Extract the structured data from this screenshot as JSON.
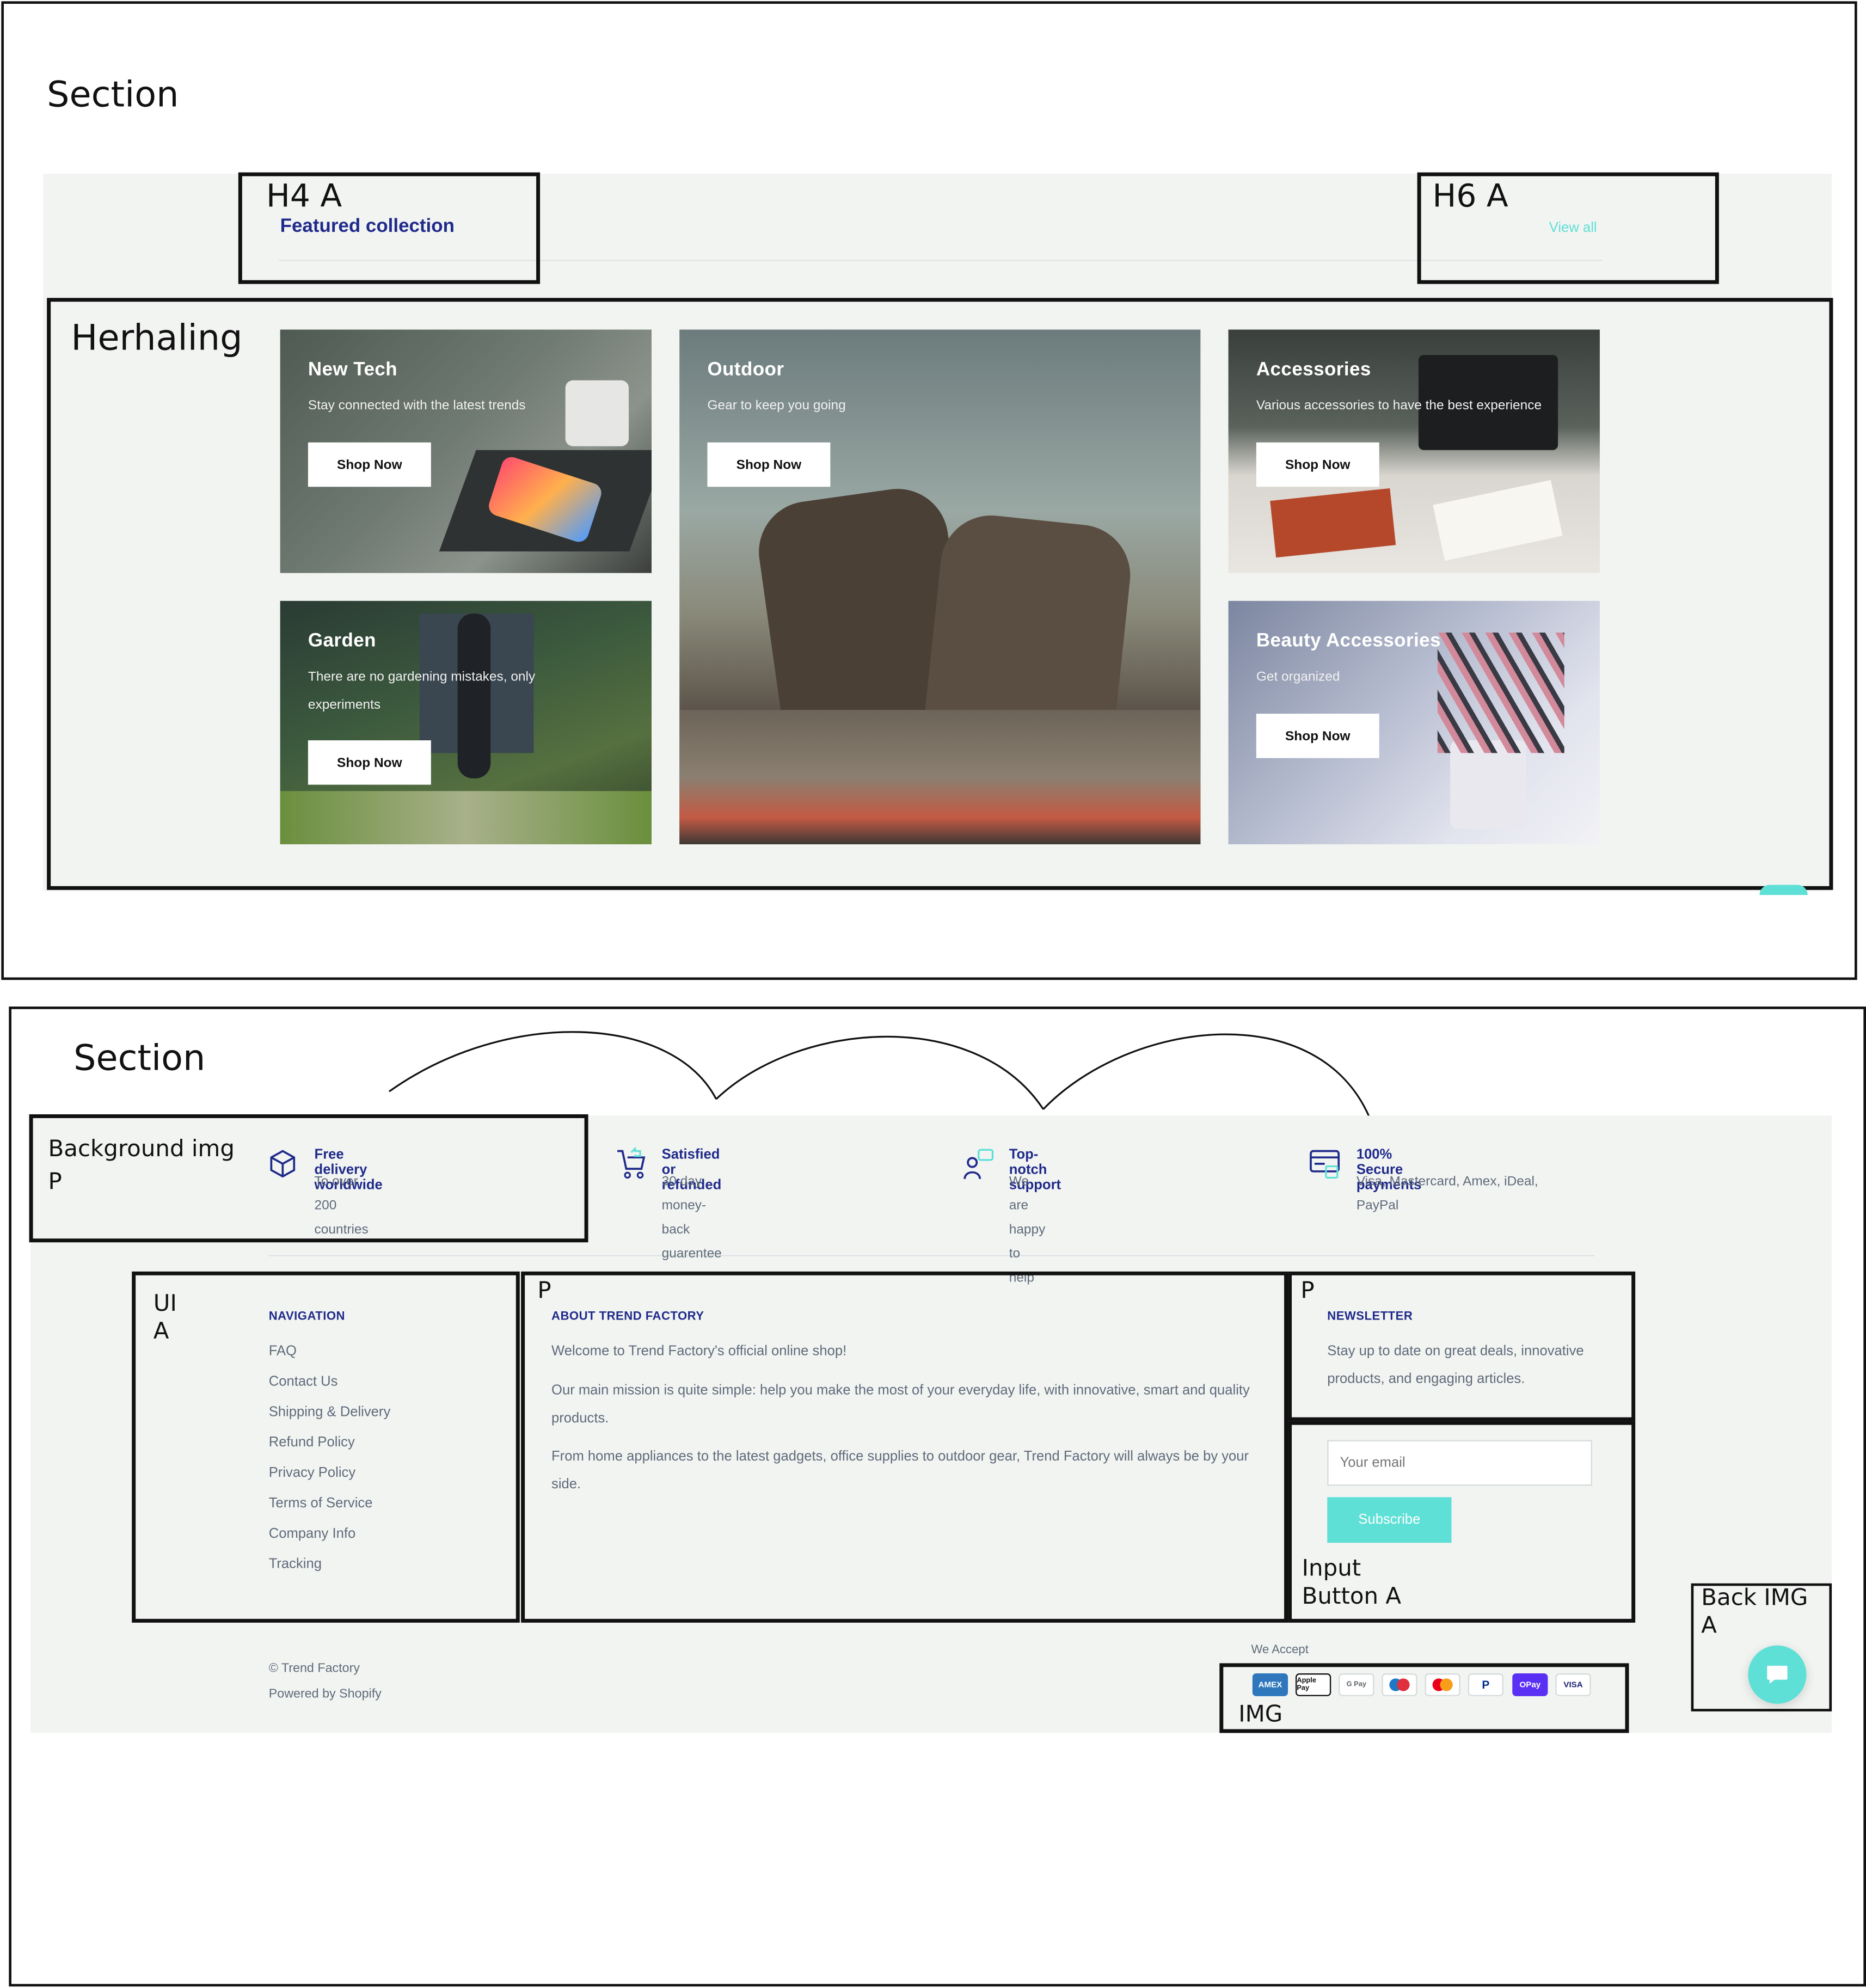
{
  "annotations": {
    "section_top": "Section",
    "h4a": "H4 A",
    "h6a": "H6 A",
    "herhaling": "Herhaling",
    "section_bottom": "Section",
    "bg_img_p": "Background img\nP",
    "ui_a": "UI\nA",
    "p_about": "P",
    "p_news": "P",
    "input_button": "Input\nButton A",
    "back_img": "Back IMG\nA",
    "img": "IMG"
  },
  "collection": {
    "heading": "Featured collection",
    "view_all": "View all",
    "cards": [
      {
        "title": "New Tech",
        "subtitle": "Stay connected with the latest trends",
        "button": "Shop Now"
      },
      {
        "title": "Outdoor",
        "subtitle": "Gear to keep you going",
        "button": "Shop Now"
      },
      {
        "title": "Accessories",
        "subtitle": "Various accessories to have the best experience",
        "button": "Shop Now"
      },
      {
        "title": "Garden",
        "subtitle": "There are no gardening mistakes, only experiments",
        "button": "Shop Now"
      },
      {
        "title": "Beauty Accessories",
        "subtitle": "Get organized",
        "button": "Shop Now"
      }
    ]
  },
  "features": [
    {
      "icon": "box-icon",
      "title": "Free delivery worldwide",
      "subtitle": "To over 200 countries"
    },
    {
      "icon": "cart-return-icon",
      "title": "Satisfied or refunded",
      "subtitle": "30 day money-back guarentee"
    },
    {
      "icon": "support-chat-icon",
      "title": "Top-notch support",
      "subtitle": "We are happy to help"
    },
    {
      "icon": "secure-card-icon",
      "title": "100% Secure payments",
      "subtitle": "Visa, Mastercard, Amex, iDeal, PayPal"
    }
  ],
  "footer": {
    "navigation": {
      "heading": "NAVIGATION",
      "links": [
        "FAQ",
        "Contact Us",
        "Shipping & Delivery",
        "Refund Policy",
        "Privacy Policy",
        "Terms of Service",
        "Company Info",
        "Tracking"
      ]
    },
    "about": {
      "heading": "ABOUT TREND FACTORY",
      "paragraphs": [
        "Welcome to Trend Factory's official online shop!",
        "Our main mission is quite simple: help you make the most of your everyday life, with innovative, smart and quality products.",
        "From home appliances to the latest gadgets, office supplies to outdoor gear, Trend Factory will always be by your side."
      ]
    },
    "newsletter": {
      "heading": "NEWSLETTER",
      "text": "Stay up to date on great deals, innovative products, and engaging articles.",
      "email_placeholder": "Your email",
      "subscribe": "Subscribe"
    },
    "copyright": "© Trend Factory",
    "powered": "Powered by Shopify",
    "we_accept": "We Accept",
    "payments": [
      "AMEX",
      "Apple Pay",
      "G Pay",
      "Maestro",
      "Mastercard",
      "PayPal",
      "OPay",
      "VISA"
    ]
  },
  "colors": {
    "navy": "#1f2a8a",
    "teal": "#5ee0d6",
    "band": "#f2f4f2",
    "muted": "#5f6b7a"
  }
}
